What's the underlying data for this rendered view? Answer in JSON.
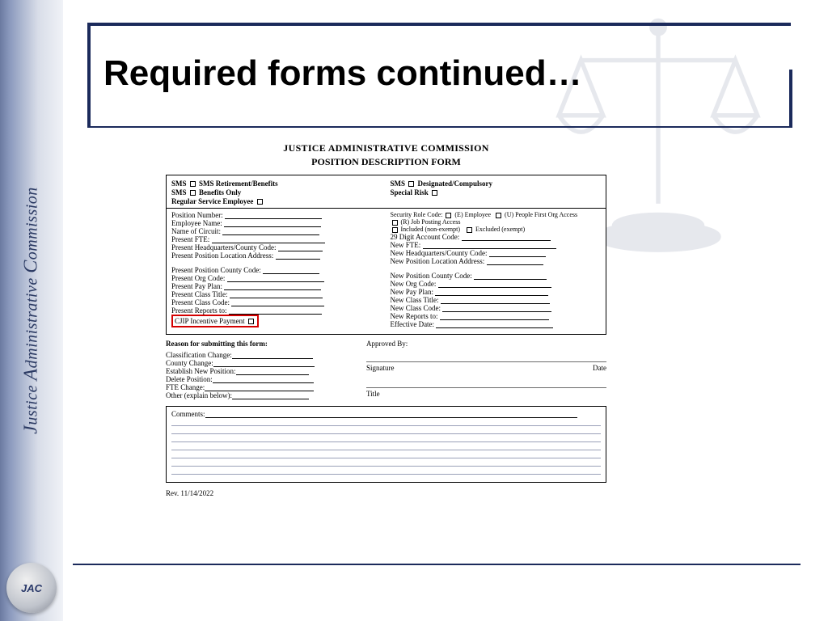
{
  "sidebar": {
    "org_text": "JUSTICE ADMINISTRATIVE COMMISSION",
    "seal_initials": "JAC"
  },
  "slide": {
    "title": "Required forms continued…"
  },
  "form": {
    "header_line1": "JUSTICE ADMINISTRATIVE COMMISSION",
    "header_line2": "POSITION DESCRIPTION FORM",
    "top": {
      "sms_retirement": "SMS Retirement/Benefits",
      "sms_prefix": "SMS",
      "sms_designated": "Designated/Compulsory",
      "sms_benefits_only": "Benefits Only",
      "special_risk": "Special Risk",
      "regular_service": "Regular Service Employee"
    },
    "left_fields": [
      "Position Number:",
      "Employee Name:",
      "Name of Circuit:",
      "Present FTE:",
      "Present Headquarters/County Code:",
      "Present Position Location Address:",
      "Present Position County Code:",
      "Present Org Code:",
      "Present Pay Plan:",
      "Present Class Title:",
      "Present Class Code:",
      "Present Reports to:"
    ],
    "cjip_label": "CJIP Incentive Payment",
    "right_top": {
      "security_role": "Security Role Code:",
      "e_employee": "(E) Employee",
      "u_people": "(U) People First Org Access",
      "r_job": "(R) Job Posting Access",
      "included": "Included (non-exempt)",
      "excluded": "Excluded (exempt)",
      "acct_code": "29 Digit Account Code:"
    },
    "right_fields": [
      "New FTE:",
      "New Headquarters/County Code:",
      "New Position Location Address:",
      "New Position County Code:",
      "New Org Code:",
      "New Pay Plan:",
      "New Class Title:",
      "New Class Code:",
      "New Reports to:",
      "Effective Date:"
    ],
    "reason_heading": "Reason for submitting this form:",
    "approved_by": "Approved By:",
    "reason_fields": [
      "Classification Change:",
      "County Change:",
      "Establish New Position:",
      "Delete Position:",
      "FTE Change:",
      "Other (explain below):"
    ],
    "sig": {
      "signature": "Signature",
      "date": "Date",
      "title": "Title"
    },
    "comments_label": "Comments:",
    "revision": "Rev. 11/14/2022"
  }
}
